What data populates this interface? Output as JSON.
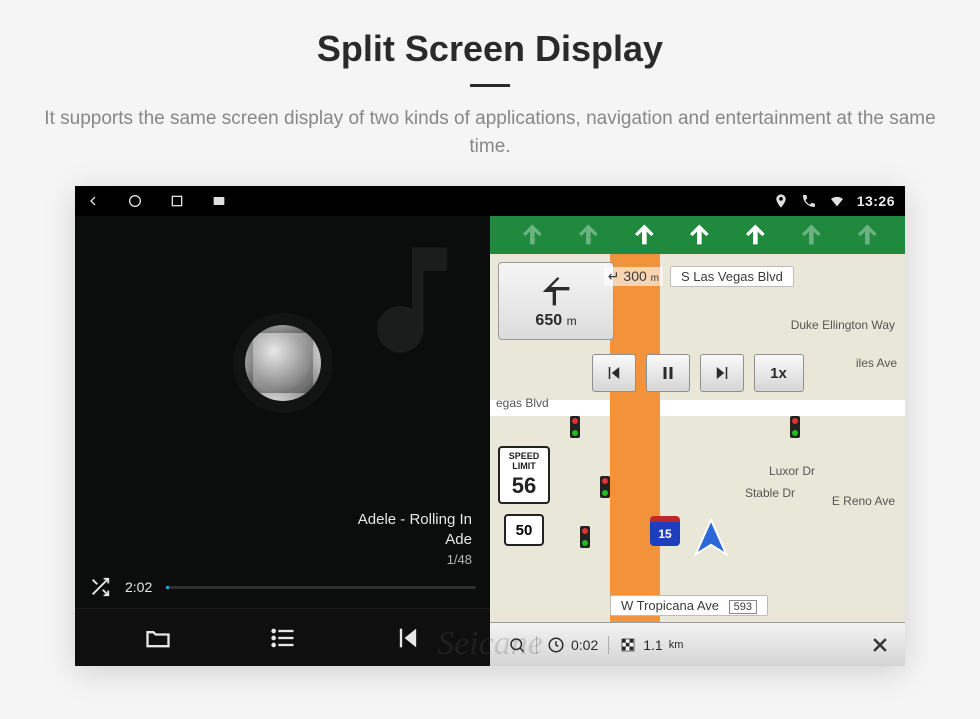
{
  "page": {
    "title": "Split Screen Display",
    "subtitle": "It supports the same screen display of two kinds of applications, navigation and entertainment at the same time."
  },
  "statusbar": {
    "time": "13:26"
  },
  "music": {
    "track_title": "Adele - Rolling In",
    "artist": "Ade",
    "track_index": "1/48",
    "elapsed": "2:02"
  },
  "nav": {
    "turn_distance_main": "650",
    "turn_distance_main_unit": "m",
    "turn_distance_sub": "300",
    "turn_distance_sub_unit": "m",
    "speed_limit_label": "SPEED LIMIT",
    "speed_limit_value": "56",
    "route_shield": "50",
    "highway_shield": "15",
    "playback_speed": "1x",
    "streets": {
      "top": "S Las Vegas Blvd",
      "right1": "Duke Ellington Way",
      "right2": "Luxor Dr",
      "right3": "E Reno Ave",
      "right4": "iles Ave",
      "left1": "egas Blvd",
      "left2": "Stable Dr",
      "bottom": "W Tropicana Ave",
      "bottom_num": "593"
    },
    "bottom": {
      "time": "0:02",
      "distance": "1.1",
      "distance_unit": "km"
    }
  },
  "watermark": "Seicane"
}
